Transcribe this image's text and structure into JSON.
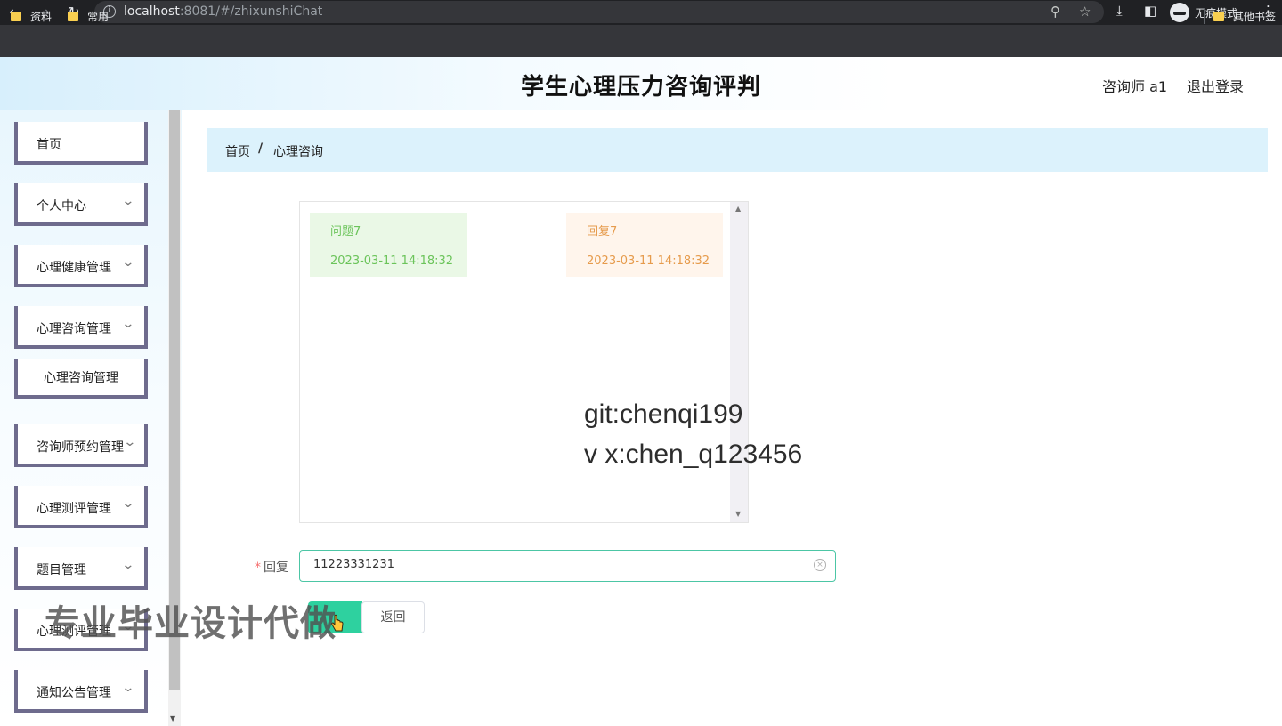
{
  "browser": {
    "url_host": "localhost",
    "url_path": ":8081/#/zhixunshiChat",
    "incognito_label": "无痕模式",
    "bookmarks": [
      "资料",
      "常用"
    ],
    "other_bookmarks": "其他书签"
  },
  "header": {
    "title": "学生心理压力咨询评判",
    "user": "咨询师 a1",
    "logout": "退出登录"
  },
  "sidebar": {
    "items": [
      {
        "label": "首页"
      },
      {
        "label": "个人中心"
      },
      {
        "label": "心理健康管理"
      },
      {
        "label": "心理咨询管理"
      },
      {
        "label": "心理咨询管理"
      },
      {
        "label": "咨询师预约管理"
      },
      {
        "label": "心理测评管理"
      },
      {
        "label": "题目管理"
      },
      {
        "label": "心理测评管理"
      },
      {
        "label": "通知公告管理"
      }
    ]
  },
  "breadcrumb": {
    "home": "首页",
    "sep": "/",
    "current": "心理咨询"
  },
  "chat": {
    "messages": [
      {
        "role": "question",
        "text": "问题7",
        "time": "2023-03-11 14:18:32",
        "color": "#6bc45a"
      },
      {
        "role": "reply",
        "text": "回复7",
        "time": "2023-03-11 14:18:32",
        "color": "#e69b4c"
      }
    ]
  },
  "form": {
    "reply_label": "回复",
    "required_mark": "*",
    "reply_value": "11223331231",
    "back_label": "返回",
    "accent": "#2ed19f"
  },
  "watermarks": {
    "line1": "git:chenqi199",
    "line2": "v x:chen_q123456",
    "cn": "专业毕业设计代做"
  }
}
